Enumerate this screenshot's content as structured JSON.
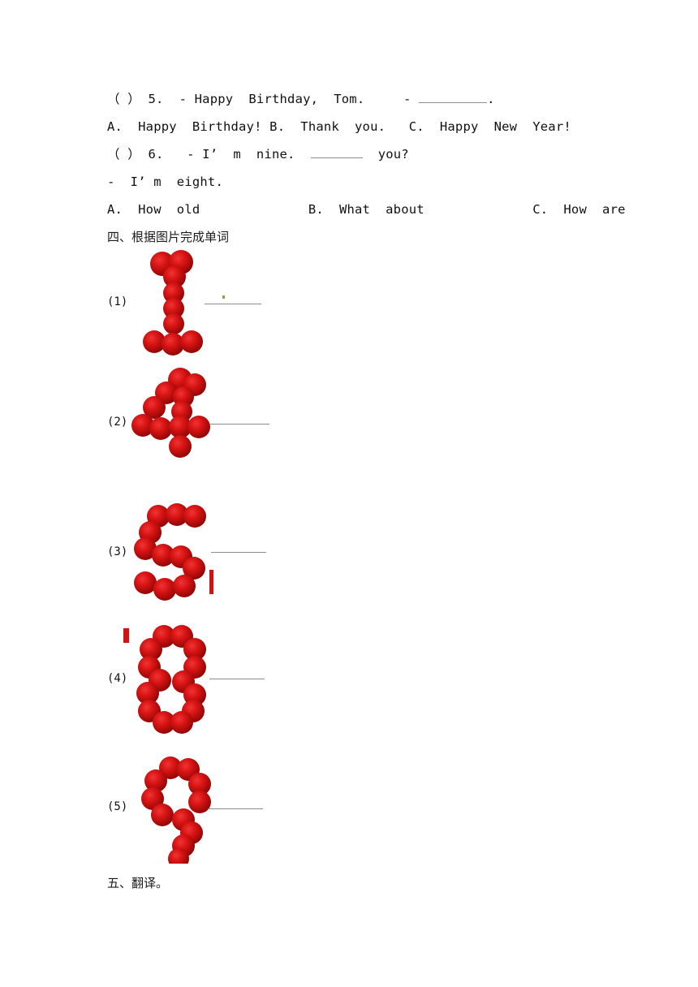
{
  "document": {
    "background_color": "#ffffff",
    "rose_color": "#cf1212",
    "rule_color": "#8d8d8d"
  },
  "multiple_choice": {
    "lines": [
      {
        "id": "q5-stem-a",
        "text": "（ ） 5.  - Happy  Birthday,  Tom.     - "
      },
      {
        "id": "q5-stem-b",
        "text": "."
      },
      {
        "id": "q5-options",
        "text": "A.  Happy  Birthday! B.  Thank  you.   C.  Happy  New  Year!"
      },
      {
        "id": "q6-stem-a",
        "text": "（ ） 6.   - I’  m  nine.  "
      },
      {
        "id": "q6-stem-b",
        "text": "  you?"
      },
      {
        "id": "q6-reply",
        "text": "-  I’ m  eight."
      },
      {
        "id": "q6-options",
        "text": "A.  How  old              B.  What  about              C.  How  are"
      }
    ]
  },
  "sections": {
    "four": "四、根据图片完成单词",
    "five": "五、翻译。"
  },
  "picture_words": {
    "items": [
      {
        "index": "(1)",
        "digit": "1",
        "answer": ""
      },
      {
        "index": "(2)",
        "digit": "4",
        "answer": ""
      },
      {
        "index": "(3)",
        "digit": "5",
        "answer": ""
      },
      {
        "index": "(4)",
        "digit": "8",
        "answer": ""
      },
      {
        "index": "(5)",
        "digit": "9",
        "answer": ""
      }
    ]
  }
}
